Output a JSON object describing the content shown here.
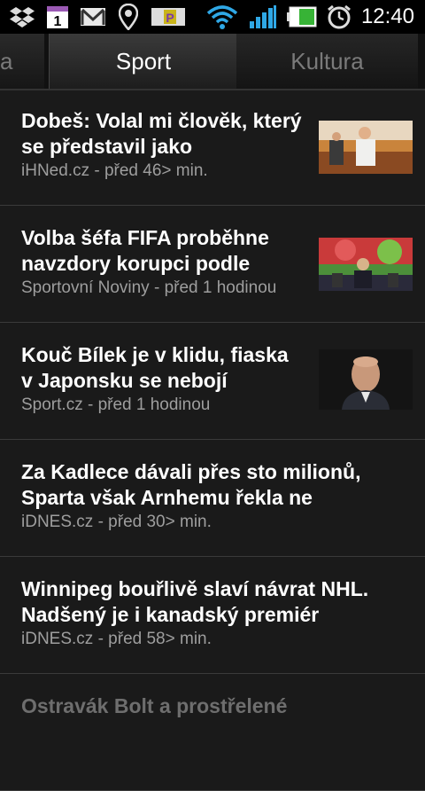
{
  "status_bar": {
    "time": "12:40",
    "icons": [
      "dropbox-icon",
      "calendar-icon",
      "gmail-icon",
      "location-icon",
      "parking-icon",
      "wifi-icon",
      "signal-icon",
      "battery-icon",
      "alarm-icon"
    ],
    "calendar_day": "1"
  },
  "tabs": [
    {
      "label": "lika"
    },
    {
      "label": "Sport"
    },
    {
      "label": "Kultura"
    }
  ],
  "articles": [
    {
      "title": "Dobeš: Volal mi člověk, který se představil jako",
      "source": "iHNed.cz - před 46> min."
    },
    {
      "title": "Volba šéfa FIFA proběhne navzdory korupci podle",
      "source": "Sportovní Noviny - před 1 hodinou"
    },
    {
      "title": "Kouč Bílek je v klidu, fiaska v Japonsku se nebojí",
      "source": "Sport.cz - před 1 hodinou"
    },
    {
      "title": "Za Kadlece dávali přes sto milionů, Sparta však Arnhemu řekla ne",
      "source": "iDNES.cz - před 30> min."
    },
    {
      "title": "Winnipeg bouřlivě slaví návrat NHL. Nadšený je i kanadský premiér",
      "source": "iDNES.cz - před 58> min."
    },
    {
      "title": "Ostravák Bolt a prostřelené"
    }
  ]
}
